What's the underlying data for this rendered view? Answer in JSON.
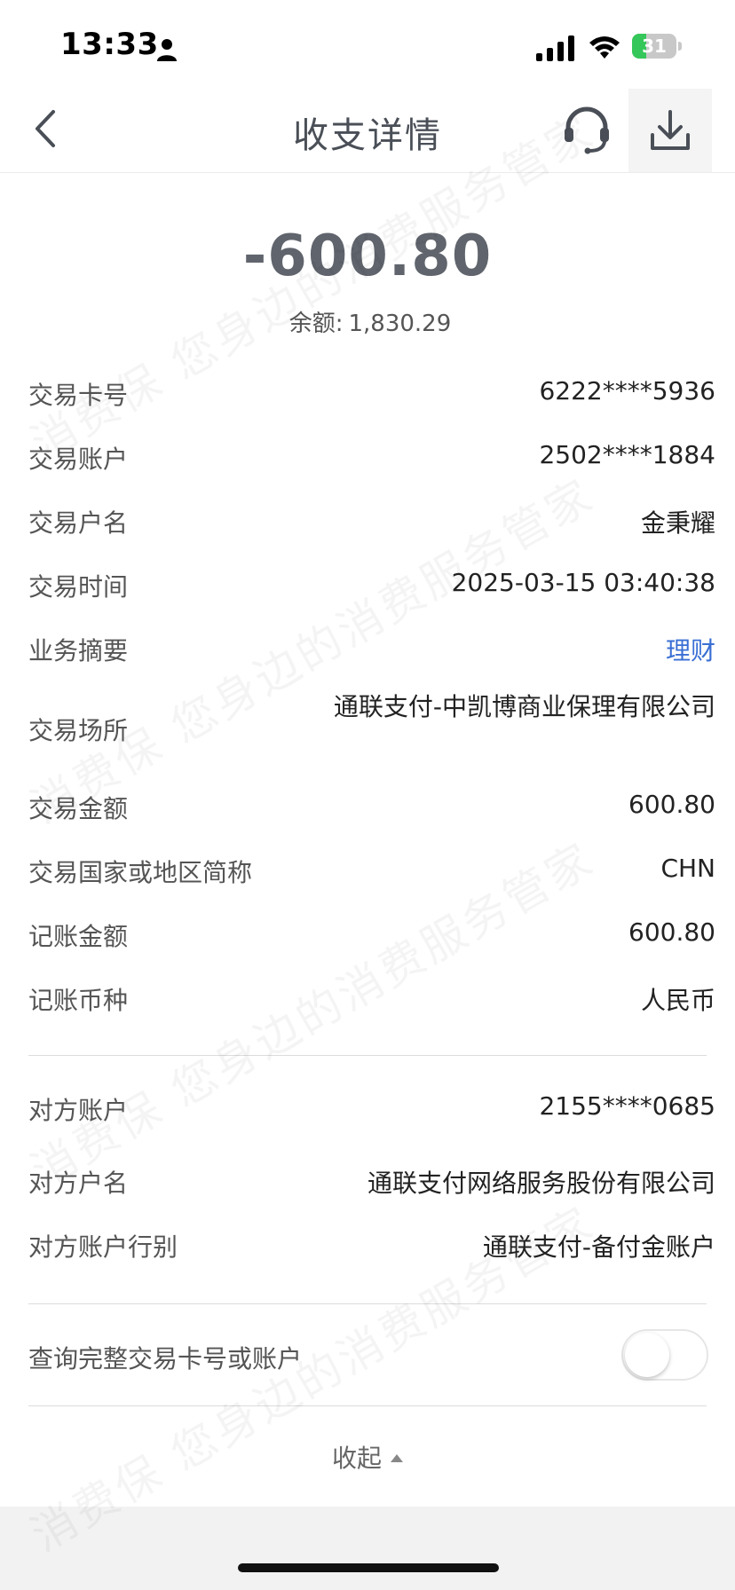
{
  "status_bar": {
    "time": "13:33",
    "battery": "31",
    "battery_level": 0.31
  },
  "nav": {
    "title": "收支详情",
    "back_icon": "chevron-left-icon",
    "service_icon": "headset-icon",
    "download_icon": "download-icon"
  },
  "summary": {
    "amount": "-600.80",
    "balance_label": "余额:",
    "balance_value": "1,830.29"
  },
  "details": [
    {
      "label": "交易卡号",
      "value": "6222****5936"
    },
    {
      "label": "交易账户",
      "value": "2502****1884"
    },
    {
      "label": "交易户名",
      "value": "金秉耀"
    },
    {
      "label": "交易时间",
      "value": "2025-03-15 03:40:38"
    },
    {
      "label": "业务摘要",
      "value": "理财"
    },
    {
      "label": "交易场所",
      "value": "通联支付-中凯博商业保理有限公司"
    },
    {
      "label": "交易金额",
      "value": "600.80"
    },
    {
      "label": "交易国家或地区简称",
      "value": "CHN"
    },
    {
      "label": "记账金额",
      "value": "600.80"
    },
    {
      "label": "记账币种",
      "value": "人民币"
    }
  ],
  "counterparty": [
    {
      "label": "对方账户",
      "value": "2155****0685"
    },
    {
      "label": "对方户名",
      "value": "通联支付网络服务股份有限公司"
    },
    {
      "label": "对方账户行别",
      "value": "通联支付-备付金账户"
    }
  ],
  "query_full": {
    "label": "查询完整交易卡号或账户",
    "enabled": false
  },
  "collapse": {
    "label": "收起"
  },
  "watermark_text": "消费保 您身边的消费服务管家",
  "colors": {
    "link": "#3a6fd4",
    "amount": "#60646c"
  }
}
